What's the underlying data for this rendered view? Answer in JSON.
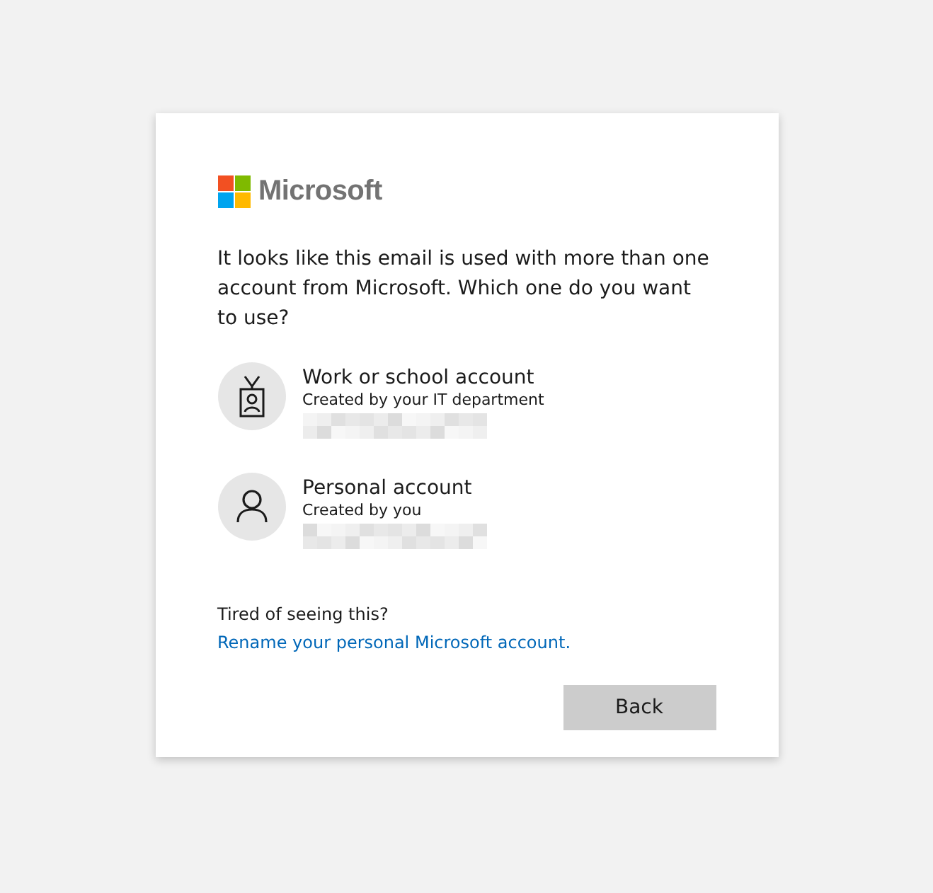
{
  "brand": {
    "name": "Microsoft"
  },
  "message": "It looks like this email is used with more than one account from Microsoft. Which one do you want to use?",
  "accounts": [
    {
      "kind": "work",
      "title": "Work or school account",
      "subtitle": "Created by your IT department"
    },
    {
      "kind": "personal",
      "title": "Personal account",
      "subtitle": "Created by you"
    }
  ],
  "footer": {
    "text": "Tired of seeing this?",
    "link": "Rename your personal Microsoft account."
  },
  "buttons": [
    {
      "label": "Back"
    }
  ]
}
